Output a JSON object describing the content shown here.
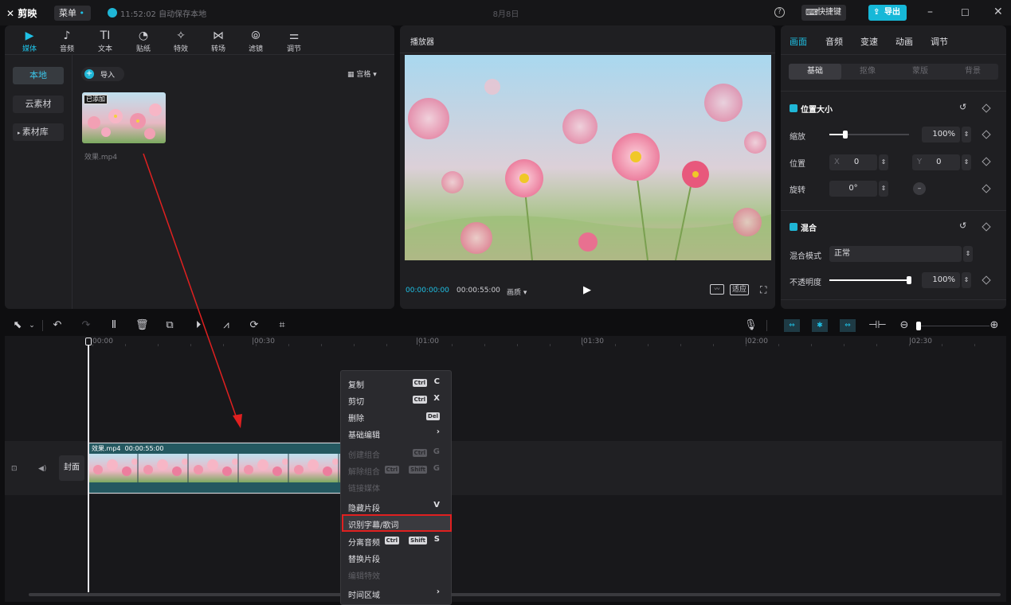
{
  "app": {
    "logo": "剪映",
    "menu_label": "菜单",
    "autosave_text": "11:52:02 自动保存本地",
    "project_title": "8月8日",
    "shortcut_label": "快捷键",
    "export_label": "导出",
    "help": "?"
  },
  "media_toolbar": [
    {
      "label": "媒体",
      "icon": "media-icon",
      "glyph": "▶",
      "active": true
    },
    {
      "label": "音频",
      "icon": "audio-icon",
      "glyph": "♪"
    },
    {
      "label": "文本",
      "icon": "text-icon",
      "glyph": "TI"
    },
    {
      "label": "贴纸",
      "icon": "sticker-icon",
      "glyph": "◔"
    },
    {
      "label": "特效",
      "icon": "effects-icon",
      "glyph": "✧"
    },
    {
      "label": "转场",
      "icon": "transition-icon",
      "glyph": "⋈"
    },
    {
      "label": "滤镜",
      "icon": "filter-icon",
      "glyph": "⦾"
    },
    {
      "label": "调节",
      "icon": "adjust-icon",
      "glyph": "⚌"
    }
  ],
  "media_sidebar": {
    "local": "本地",
    "cloud": "云素材",
    "library": "素材库"
  },
  "media": {
    "import_label": "导入",
    "view_label": "宫格",
    "added_badge": "已添加",
    "clip_name": "效果.mp4"
  },
  "player": {
    "title": "播放器",
    "current_time": "00:00:00:00",
    "total_time": "00:00:55:00",
    "quality_label": "画质",
    "fit_label": "适应"
  },
  "props": {
    "tabs": [
      "画面",
      "音频",
      "变速",
      "动画",
      "调节"
    ],
    "subtabs": [
      "基础",
      "抠像",
      "蒙版",
      "背景"
    ],
    "position_size": "位置大小",
    "scale_label": "缩放",
    "scale_value": "100%",
    "scale_fraction": 0.2,
    "position_label": "位置",
    "x_label": "X",
    "x_value": "0",
    "y_label": "Y",
    "y_value": "0",
    "rotate_label": "旋转",
    "rotate_value": "0°",
    "blend_section": "混合",
    "blend_mode_label": "混合模式",
    "blend_mode_value": "正常",
    "opacity_label": "不透明度",
    "opacity_value": "100%",
    "opacity_fraction": 1.0
  },
  "timeline": {
    "ruler": [
      "00:00",
      "|00:30",
      "|01:00",
      "|01:30",
      "|02:00",
      "|02:30"
    ],
    "cover_label": "封面",
    "clip_name": "效果.mp4",
    "clip_duration": "00:00:55:00"
  },
  "context_menu": [
    {
      "label": "复制",
      "kbd": [
        "Ctrl"
      ],
      "key": "C",
      "dim": false
    },
    {
      "label": "剪切",
      "kbd": [
        "Ctrl"
      ],
      "key": "X",
      "dim": false
    },
    {
      "label": "删除",
      "kbd": [
        "Del"
      ],
      "key": "",
      "dim": false
    },
    {
      "label": "基础编辑",
      "kbd": [],
      "key": "›",
      "dim": false
    },
    {
      "label": "创建组合",
      "kbd": [
        "Ctrl"
      ],
      "key": "G",
      "dim": true
    },
    {
      "label": "解除组合",
      "kbd": [
        "Ctrl",
        "Shift"
      ],
      "key": "G",
      "dim": true
    },
    {
      "label": "链接媒体",
      "kbd": [],
      "key": "",
      "dim": true
    },
    {
      "label": "隐藏片段",
      "kbd": [],
      "key": "V",
      "dim": false
    },
    {
      "label": "识别字幕/歌词",
      "kbd": [],
      "key": "",
      "dim": false,
      "highlight": true
    },
    {
      "label": "分离音频",
      "kbd": [
        "Ctrl",
        "Shift"
      ],
      "key": "S",
      "dim": false
    },
    {
      "label": "替换片段",
      "kbd": [],
      "key": "",
      "dim": false
    },
    {
      "label": "编辑特效",
      "kbd": [],
      "key": "",
      "dim": true
    },
    {
      "label": "时间区域",
      "kbd": [],
      "key": "›",
      "dim": false
    }
  ],
  "colors": {
    "accent": "#1fc1e6",
    "highlight_box": "#e02020",
    "annotation_arrow": "#e02020"
  }
}
